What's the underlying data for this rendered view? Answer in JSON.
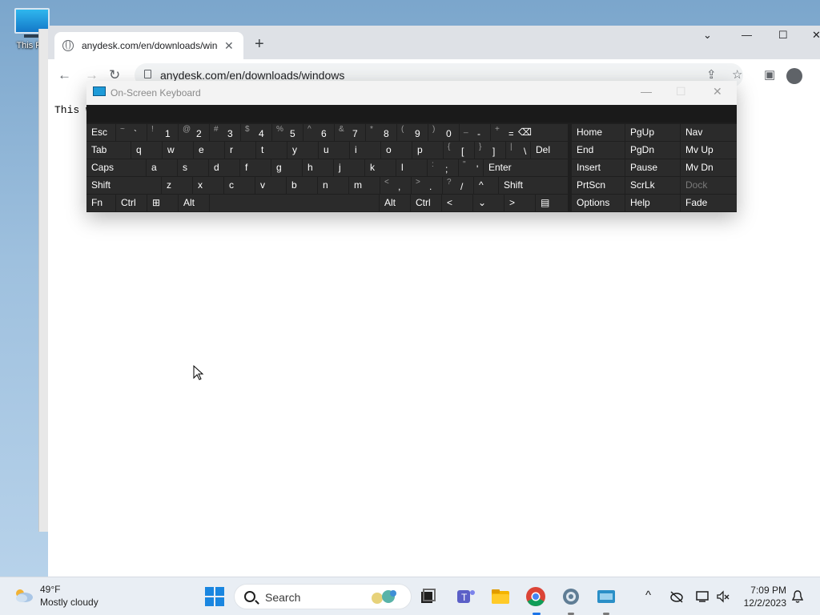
{
  "desktop": {
    "icon_label": "This PC"
  },
  "browser": {
    "tab_title": "anydesk.com/en/downloads/windows",
    "tab_close": "✕",
    "new_tab": "+",
    "win_collapse": "⌄",
    "win_minimize": "—",
    "win_maximize": "☐",
    "win_close": "✕",
    "back": "←",
    "forward": "→",
    "reload": "↻",
    "url": "anydesk.com/en/downloads/windows",
    "share": "⇪",
    "bookmark": "☆",
    "sidepanel": "▣",
    "page_text": "This w"
  },
  "osk": {
    "title": "On-Screen Keyboard",
    "minimize": "—",
    "maximize": "☐",
    "close": "✕",
    "row1": [
      {
        "label": "Esc"
      },
      {
        "shift": "~",
        "primary": "`"
      },
      {
        "shift": "!",
        "primary": "1"
      },
      {
        "shift": "@",
        "primary": "2"
      },
      {
        "shift": "#",
        "primary": "3"
      },
      {
        "shift": "$",
        "primary": "4"
      },
      {
        "shift": "%",
        "primary": "5"
      },
      {
        "shift": "^",
        "primary": "6"
      },
      {
        "shift": "&",
        "primary": "7"
      },
      {
        "shift": "*",
        "primary": "8"
      },
      {
        "shift": "(",
        "primary": "9"
      },
      {
        "shift": ")",
        "primary": "0"
      },
      {
        "shift": "_",
        "primary": "-"
      },
      {
        "shift": "+",
        "primary": "="
      },
      {
        "label": "⌫"
      }
    ],
    "row2": [
      {
        "label": "Tab"
      },
      {
        "label": "q"
      },
      {
        "label": "w"
      },
      {
        "label": "e"
      },
      {
        "label": "r"
      },
      {
        "label": "t"
      },
      {
        "label": "y"
      },
      {
        "label": "u"
      },
      {
        "label": "i"
      },
      {
        "label": "o"
      },
      {
        "label": "p"
      },
      {
        "shift": "{",
        "primary": "["
      },
      {
        "shift": "}",
        "primary": "]"
      },
      {
        "shift": "|",
        "primary": "\\"
      },
      {
        "label": "Del"
      }
    ],
    "row3": [
      {
        "label": "Caps"
      },
      {
        "label": "a"
      },
      {
        "label": "s"
      },
      {
        "label": "d"
      },
      {
        "label": "f"
      },
      {
        "label": "g"
      },
      {
        "label": "h"
      },
      {
        "label": "j"
      },
      {
        "label": "k"
      },
      {
        "label": "l"
      },
      {
        "shift": ":",
        "primary": ";"
      },
      {
        "shift": "\"",
        "primary": "'"
      },
      {
        "label": "Enter"
      }
    ],
    "row4": [
      {
        "label": "Shift"
      },
      {
        "label": "z"
      },
      {
        "label": "x"
      },
      {
        "label": "c"
      },
      {
        "label": "v"
      },
      {
        "label": "b"
      },
      {
        "label": "n"
      },
      {
        "label": "m"
      },
      {
        "shift": "<",
        "primary": ","
      },
      {
        "shift": ">",
        "primary": "."
      },
      {
        "shift": "?",
        "primary": "/"
      },
      {
        "label": "^"
      },
      {
        "label": "Shift"
      }
    ],
    "row5": [
      {
        "label": "Fn"
      },
      {
        "label": "Ctrl"
      },
      {
        "label": "⊞"
      },
      {
        "label": "Alt"
      },
      {
        "label": ""
      },
      {
        "label": "Alt"
      },
      {
        "label": "Ctrl"
      },
      {
        "label": "<"
      },
      {
        "label": "⌄"
      },
      {
        "label": ">"
      },
      {
        "label": "▤"
      }
    ],
    "nav": [
      [
        "Home",
        "PgUp",
        "Nav"
      ],
      [
        "End",
        "PgDn",
        "Mv Up"
      ],
      [
        "Insert",
        "Pause",
        "Mv Dn"
      ],
      [
        "PrtScn",
        "ScrLk",
        "Dock"
      ],
      [
        "Options",
        "Help",
        "Fade"
      ]
    ]
  },
  "taskbar": {
    "temperature": "49°F",
    "condition": "Mostly cloudy",
    "search_label": "Search",
    "tray_chevron": "^",
    "time": "7:09 PM",
    "date": "12/2/2023",
    "bell": "🔔"
  }
}
